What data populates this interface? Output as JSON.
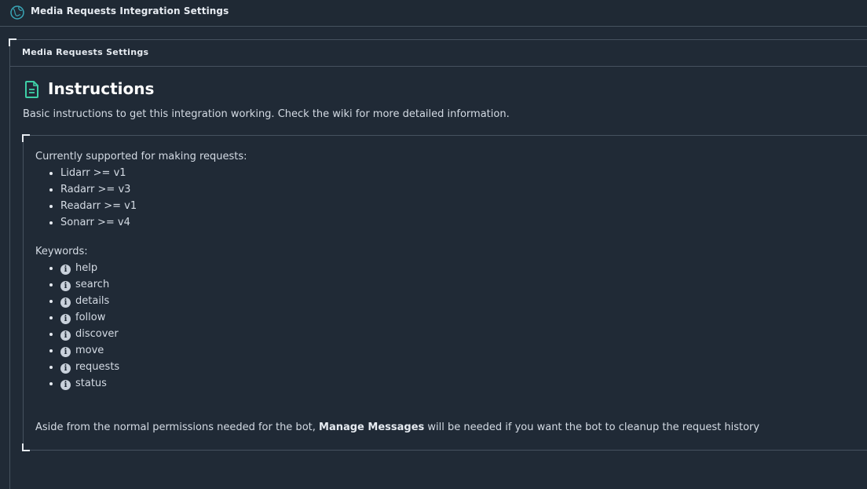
{
  "app": {
    "title": "Media Requests Integration Settings",
    "logo_icon": "globe-icon"
  },
  "panel": {
    "title": "Media Requests Settings"
  },
  "instructions": {
    "title": "Instructions",
    "icon": "file-text-icon",
    "accent_color": "#3ecfa6",
    "description": "Basic instructions to get this integration working. Check the wiki for more detailed information."
  },
  "supported": {
    "heading": "Currently supported for making requests:",
    "items": [
      "Lidarr >= v1",
      "Radarr >= v3",
      "Readarr >= v1",
      "Sonarr >= v4"
    ]
  },
  "keywords": {
    "heading": "Keywords:",
    "icon": "info-icon",
    "items": [
      "help",
      "search",
      "details",
      "follow",
      "discover",
      "move",
      "requests",
      "status"
    ]
  },
  "aside": {
    "prefix": "Aside from the normal permissions needed for the bot, ",
    "emphasis": "Manage Messages",
    "suffix": " will be needed if you want the bot to cleanup the request history"
  },
  "colors": {
    "background": "#202a36",
    "border": "#46525f",
    "text": "#d4dbe4"
  }
}
